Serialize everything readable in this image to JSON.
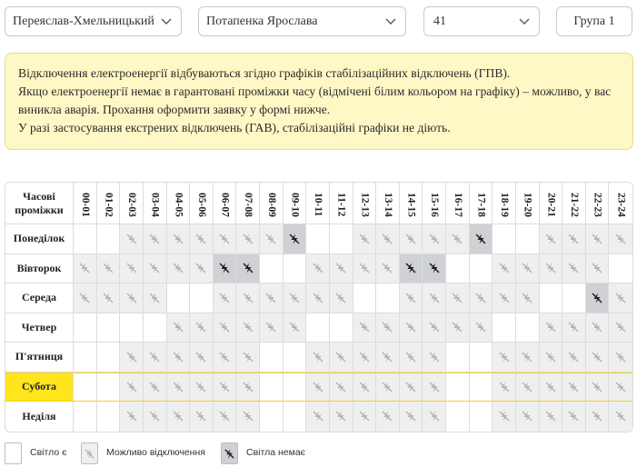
{
  "filters": {
    "city": "Переяслав-Хмельницький",
    "street": "Потапенка Ярослава",
    "house": "41",
    "group": "Група 1"
  },
  "notice": [
    "Відключення електроенергії відбуваються згідно графіків стабілізаційних відключень (ГПВ).",
    "Якщо електроенергії немає в гарантовані проміжки часу (відмічені білим кольором на графіку) – можливо, у вас виникла аварія. Прохання оформити заявку у формі нижче.",
    "У разі застосування екстрених відключень (ГАВ), стабілізаційні графіки не діють."
  ],
  "table": {
    "corner": "Часові проміжки",
    "hours": [
      "00-01",
      "01-02",
      "02-03",
      "03-04",
      "04-05",
      "05-06",
      "06-07",
      "07-08",
      "08-09",
      "09-10",
      "10-11",
      "11-12",
      "12-13",
      "13-14",
      "14-15",
      "15-16",
      "16-17",
      "17-18",
      "18-19",
      "19-20",
      "20-21",
      "21-22",
      "22-23",
      "23-24"
    ],
    "today_index": 5,
    "days": [
      {
        "name": "Понеділок",
        "slots": "mmoommmmmmmoommmmmmoommmm"
      },
      {
        "name": "Вівторок",
        "slots": "oommmmmmoommmmmmoommmmmmm"
      },
      {
        "name": "Середа",
        "slots": "mmmmmmoommmmmmoommmmmmmoo"
      },
      {
        "name": "Четвер",
        "slots": "mmmmoommmmmmoommmmmmoommm"
      },
      {
        "name": "П'ятниця",
        "slots": "mmoommmmmmoommmmmmoommmmm"
      },
      {
        "name": "Субота",
        "slots": "mmoommmmmmoommmmmmoommmmm"
      },
      {
        "name": "Неділя",
        "slots": "mmoommmmmmoommmmmmoommmmm"
      }
    ]
  },
  "legend": {
    "on": "Світло є",
    "maybe": "Можливо відключення",
    "off": "Світла немає"
  },
  "colors": {
    "notice_bg": "#fef8c6",
    "today": "#ffe51e",
    "maybe": "#efefef",
    "off": "#cfd1d4"
  }
}
